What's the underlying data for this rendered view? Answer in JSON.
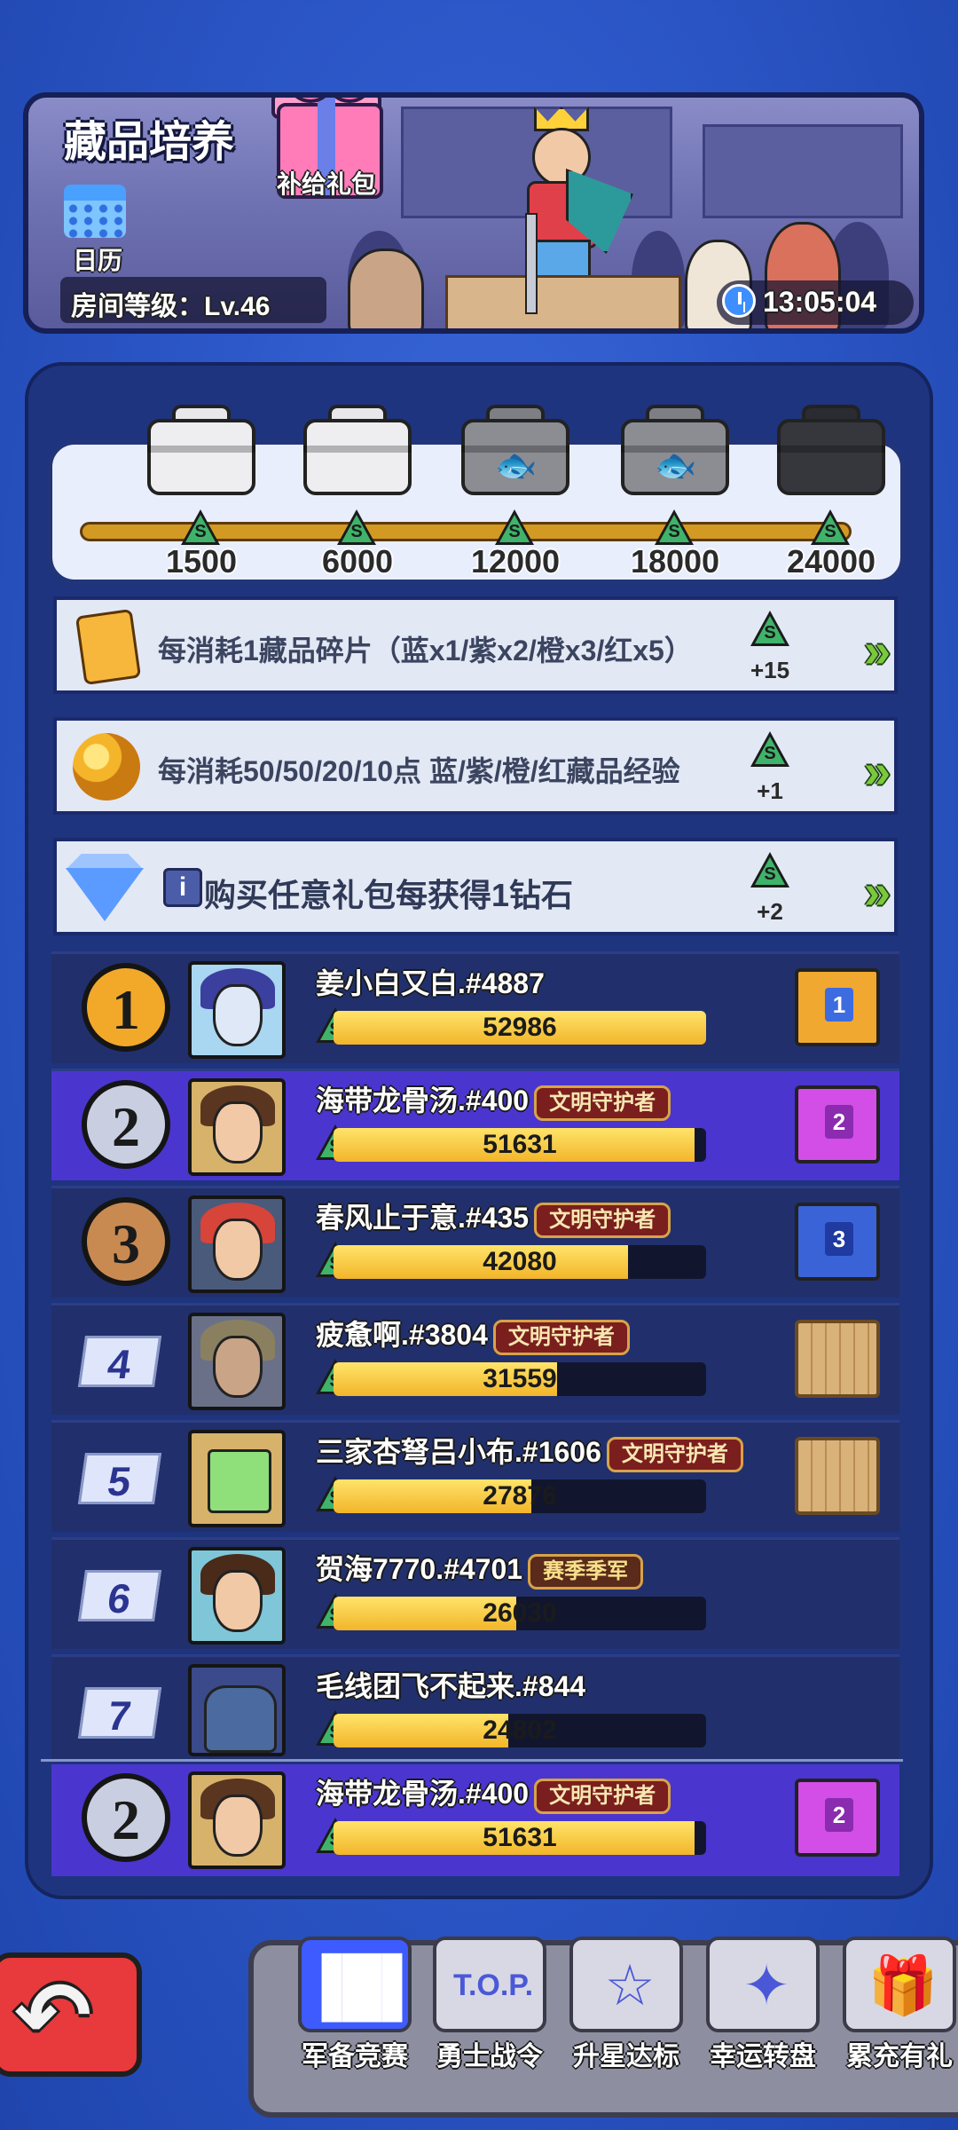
{
  "header": {
    "title": "藏品培养",
    "gift_label": "补给礼包",
    "calendar_label": "日历",
    "room_level": "房间等级：Lv.46",
    "timer": "13:05:04"
  },
  "milestones": [
    {
      "value": "1500",
      "chest": "white"
    },
    {
      "value": "6000",
      "chest": "white"
    },
    {
      "value": "12000",
      "chest": "grey-fish"
    },
    {
      "value": "18000",
      "chest": "grey-fish"
    },
    {
      "value": "24000",
      "chest": "black"
    }
  ],
  "tasks": [
    {
      "text": "每消耗1藏品碎片（蓝x1/紫x2/橙x3/红x5）",
      "reward": "+15",
      "icon": "fragment-icon"
    },
    {
      "text": "每消耗50/50/20/10点 蓝/紫/橙/红藏品经验",
      "reward": "+1",
      "icon": "honeycomb-icon"
    },
    {
      "text": "购买任意礼包每获得1钻石",
      "reward": "+2",
      "icon": "diamond-icon",
      "info": "i"
    }
  ],
  "leaderboard": [
    {
      "rank": "1",
      "name": "姜小白又白.#4887",
      "title": "",
      "score": "52986",
      "progress": 1.0
    },
    {
      "rank": "2",
      "name": "海带龙骨汤.#400",
      "title": "文明守护者",
      "score": "51631",
      "progress": 0.97
    },
    {
      "rank": "3",
      "name": "春风止于意.#435",
      "title": "文明守护者",
      "score": "42080",
      "progress": 0.79
    },
    {
      "rank": "4",
      "name": "疲惫啊.#3804",
      "title": "文明守护者",
      "score": "31559",
      "progress": 0.6
    },
    {
      "rank": "5",
      "name": "三家杏弩吕小布.#1606",
      "title": "文明守护者",
      "score": "27876",
      "progress": 0.53
    },
    {
      "rank": "6",
      "name": "贺海7770.#4701",
      "title": "赛季季军",
      "score": "26030",
      "progress": 0.49
    },
    {
      "rank": "7",
      "name": "毛线团飞不起来.#844",
      "title": "",
      "score": "24802",
      "progress": 0.47
    }
  ],
  "my_rank": {
    "rank": "2",
    "name": "海带龙骨汤.#400",
    "title": "文明守护者",
    "score": "51631",
    "progress": 0.97
  },
  "crates": {
    "1": "1",
    "2": "2",
    "3": "3"
  },
  "nav": [
    {
      "label": "军备竞赛",
      "icon": "bar-chart-icon",
      "active": true
    },
    {
      "label": "勇士战令",
      "icon": "ticket-icon",
      "active": false
    },
    {
      "label": "升星达标",
      "icon": "star-icon",
      "active": false
    },
    {
      "label": "幸运转盘",
      "icon": "lucky-box-icon",
      "active": false
    },
    {
      "label": "累充有礼",
      "icon": "gift-icon",
      "active": false
    }
  ],
  "colors": {
    "background": "#2d58c9",
    "panel": "#1e347e",
    "highlight_row": "#4b35cf",
    "progress_fill": "#f2b52a",
    "s_token": "#3fb36a",
    "arrow": "#7ac93a",
    "back_button": "#e8393c"
  }
}
